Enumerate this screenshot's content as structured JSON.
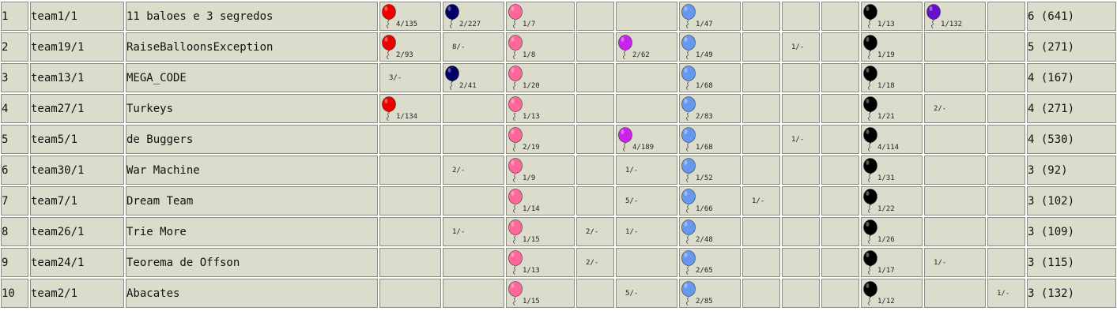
{
  "colors": {
    "red": "#ee0000",
    "navy": "#000066",
    "pink": "#ff6699",
    "purple": "#cc22ee",
    "blue": "#6699ee",
    "black": "#000000",
    "violet": "#6611cc"
  },
  "rows": [
    {
      "place": "1",
      "team": "team1/1",
      "name": "11 baloes e 3 segredos",
      "cells": [
        {
          "t": "4/135",
          "c": "red"
        },
        {
          "t": "2/227",
          "c": "navy"
        },
        {
          "t": "1/7",
          "c": "pink"
        },
        {
          "t": ""
        },
        {
          "t": ""
        },
        {
          "t": "1/47",
          "c": "blue"
        },
        {
          "t": ""
        },
        {
          "t": ""
        },
        {
          "t": ""
        },
        {
          "t": "1/13",
          "c": "black"
        },
        {
          "t": "1/132",
          "c": "violet"
        },
        {
          "t": ""
        }
      ],
      "score": "6 (641)"
    },
    {
      "place": "2",
      "team": "team19/1",
      "name": "RaiseBalloonsException",
      "cells": [
        {
          "t": "2/93",
          "c": "red"
        },
        {
          "t": "8/-"
        },
        {
          "t": "1/8",
          "c": "pink"
        },
        {
          "t": ""
        },
        {
          "t": "2/62",
          "c": "purple"
        },
        {
          "t": "1/49",
          "c": "blue"
        },
        {
          "t": ""
        },
        {
          "t": "1/-"
        },
        {
          "t": ""
        },
        {
          "t": "1/19",
          "c": "black"
        },
        {
          "t": ""
        },
        {
          "t": ""
        }
      ],
      "score": "5 (271)"
    },
    {
      "place": "3",
      "team": "team13/1",
      "name": "MEGA_CODE",
      "cells": [
        {
          "t": "3/-"
        },
        {
          "t": "2/41",
          "c": "navy"
        },
        {
          "t": "1/20",
          "c": "pink"
        },
        {
          "t": ""
        },
        {
          "t": ""
        },
        {
          "t": "1/68",
          "c": "blue"
        },
        {
          "t": ""
        },
        {
          "t": ""
        },
        {
          "t": ""
        },
        {
          "t": "1/18",
          "c": "black"
        },
        {
          "t": ""
        },
        {
          "t": ""
        }
      ],
      "score": "4 (167)"
    },
    {
      "place": "4",
      "team": "team27/1",
      "name": "Turkeys",
      "cells": [
        {
          "t": "1/134",
          "c": "red"
        },
        {
          "t": ""
        },
        {
          "t": "1/13",
          "c": "pink"
        },
        {
          "t": ""
        },
        {
          "t": ""
        },
        {
          "t": "2/83",
          "c": "blue"
        },
        {
          "t": ""
        },
        {
          "t": ""
        },
        {
          "t": ""
        },
        {
          "t": "1/21",
          "c": "black"
        },
        {
          "t": "2/-"
        },
        {
          "t": ""
        }
      ],
      "score": "4 (271)"
    },
    {
      "place": "5",
      "team": "team5/1",
      "name": "de Buggers",
      "cells": [
        {
          "t": ""
        },
        {
          "t": ""
        },
        {
          "t": "2/19",
          "c": "pink"
        },
        {
          "t": ""
        },
        {
          "t": "4/189",
          "c": "purple"
        },
        {
          "t": "1/68",
          "c": "blue"
        },
        {
          "t": ""
        },
        {
          "t": "1/-"
        },
        {
          "t": ""
        },
        {
          "t": "4/114",
          "c": "black"
        },
        {
          "t": ""
        },
        {
          "t": ""
        }
      ],
      "score": "4 (530)"
    },
    {
      "place": "6",
      "team": "team30/1",
      "name": "War Machine",
      "cells": [
        {
          "t": ""
        },
        {
          "t": "2/-"
        },
        {
          "t": "1/9",
          "c": "pink"
        },
        {
          "t": ""
        },
        {
          "t": "1/-"
        },
        {
          "t": "1/52",
          "c": "blue"
        },
        {
          "t": ""
        },
        {
          "t": ""
        },
        {
          "t": ""
        },
        {
          "t": "1/31",
          "c": "black"
        },
        {
          "t": ""
        },
        {
          "t": ""
        }
      ],
      "score": "3 (92)"
    },
    {
      "place": "7",
      "team": "team7/1",
      "name": "Dream Team",
      "cells": [
        {
          "t": ""
        },
        {
          "t": ""
        },
        {
          "t": "1/14",
          "c": "pink"
        },
        {
          "t": ""
        },
        {
          "t": "5/-"
        },
        {
          "t": "1/66",
          "c": "blue"
        },
        {
          "t": "1/-"
        },
        {
          "t": ""
        },
        {
          "t": ""
        },
        {
          "t": "1/22",
          "c": "black"
        },
        {
          "t": ""
        },
        {
          "t": ""
        }
      ],
      "score": "3 (102)"
    },
    {
      "place": "8",
      "team": "team26/1",
      "name": "Trie More",
      "cells": [
        {
          "t": ""
        },
        {
          "t": "1/-"
        },
        {
          "t": "1/15",
          "c": "pink"
        },
        {
          "t": "2/-"
        },
        {
          "t": "1/-"
        },
        {
          "t": "2/48",
          "c": "blue"
        },
        {
          "t": ""
        },
        {
          "t": ""
        },
        {
          "t": ""
        },
        {
          "t": "1/26",
          "c": "black"
        },
        {
          "t": ""
        },
        {
          "t": ""
        }
      ],
      "score": "3 (109)"
    },
    {
      "place": "9",
      "team": "team24/1",
      "name": "Teorema de Offson",
      "cells": [
        {
          "t": ""
        },
        {
          "t": ""
        },
        {
          "t": "1/13",
          "c": "pink"
        },
        {
          "t": "2/-"
        },
        {
          "t": ""
        },
        {
          "t": "2/65",
          "c": "blue"
        },
        {
          "t": ""
        },
        {
          "t": ""
        },
        {
          "t": ""
        },
        {
          "t": "1/17",
          "c": "black"
        },
        {
          "t": "1/-"
        },
        {
          "t": ""
        }
      ],
      "score": "3 (115)"
    },
    {
      "place": "10",
      "team": "team2/1",
      "name": "Abacates",
      "cells": [
        {
          "t": ""
        },
        {
          "t": ""
        },
        {
          "t": "1/15",
          "c": "pink"
        },
        {
          "t": ""
        },
        {
          "t": "5/-"
        },
        {
          "t": "2/85",
          "c": "blue"
        },
        {
          "t": ""
        },
        {
          "t": ""
        },
        {
          "t": ""
        },
        {
          "t": "1/12",
          "c": "black"
        },
        {
          "t": ""
        },
        {
          "t": "1/-"
        }
      ],
      "score": "3 (132)"
    }
  ]
}
